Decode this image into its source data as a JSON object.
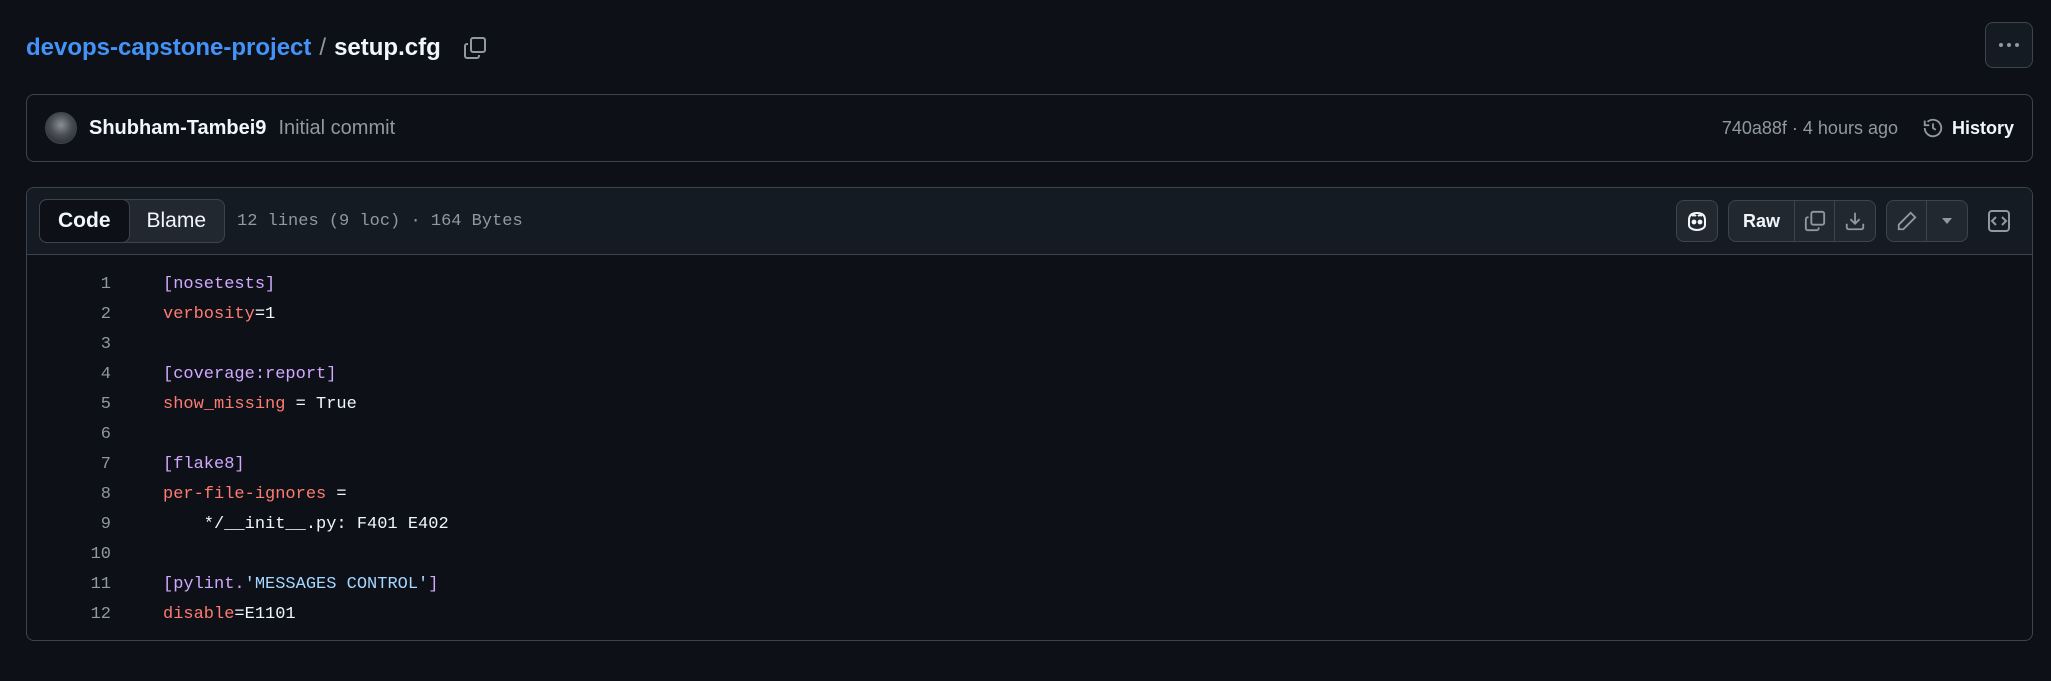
{
  "breadcrumb": {
    "repo": "devops-capstone-project",
    "separator": "/",
    "file": "setup.cfg"
  },
  "commit": {
    "author": "Shubham-Tambei9",
    "message": "Initial commit",
    "sha_time": "740a88f · 4 hours ago",
    "history_label": "History"
  },
  "file": {
    "tabs": {
      "code": "Code",
      "blame": "Blame"
    },
    "info": "12 lines (9 loc) · 164 Bytes",
    "raw_label": "Raw"
  },
  "code": {
    "lines": [
      {
        "n": "1",
        "a": "[nosetests]",
        "b": "",
        "c": "",
        "d": ""
      },
      {
        "n": "2",
        "a": "verbosity",
        "b": "=1",
        "c": "",
        "d": ""
      },
      {
        "n": "3",
        "a": "",
        "b": "",
        "c": "",
        "d": ""
      },
      {
        "n": "4",
        "a": "[coverage:report]",
        "b": "",
        "c": "",
        "d": ""
      },
      {
        "n": "5",
        "a": "show_missing",
        "b": " = True",
        "c": "",
        "d": ""
      },
      {
        "n": "6",
        "a": "",
        "b": "",
        "c": "",
        "d": ""
      },
      {
        "n": "7",
        "a": "[flake8]",
        "b": "",
        "c": "",
        "d": ""
      },
      {
        "n": "8",
        "a": "per-file-ignores",
        "b": " =",
        "c": "",
        "d": ""
      },
      {
        "n": "9",
        "a": "",
        "b": "    */__init__.py: F401 E402",
        "c": "",
        "d": ""
      },
      {
        "n": "10",
        "a": "",
        "b": "",
        "c": "",
        "d": ""
      },
      {
        "n": "11",
        "a": "[pylint.",
        "b": "",
        "c": "'MESSAGES CONTROL'",
        "d": "]"
      },
      {
        "n": "12",
        "a": "disable",
        "b": "=E1101",
        "c": "",
        "d": ""
      }
    ]
  },
  "colors": {
    "link": "#4493f8",
    "section": "#d2a8ff",
    "key": "#ff7b72",
    "string": "#a5d6ff"
  }
}
